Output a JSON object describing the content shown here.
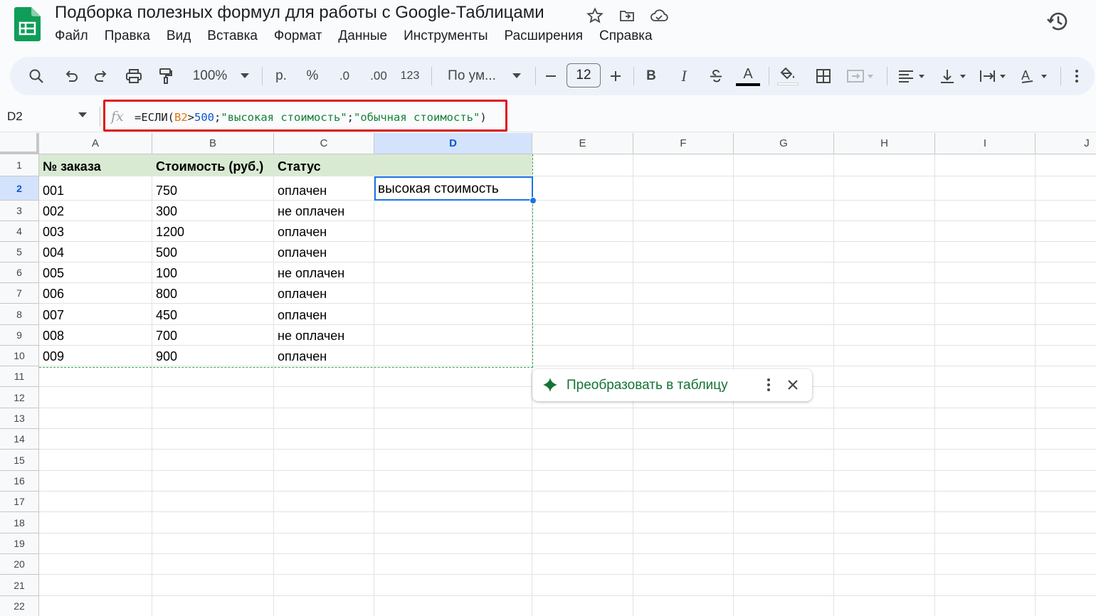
{
  "doc": {
    "title": "Подборка полезных формул для работы с Google-Таблицами"
  },
  "menu": [
    "Файл",
    "Правка",
    "Вид",
    "Вставка",
    "Формат",
    "Данные",
    "Инструменты",
    "Расширения",
    "Справка"
  ],
  "toolbar": {
    "zoom": "100%",
    "currency": "р.",
    "percent": "%",
    "decrease_decimal": ".0",
    "increase_decimal": ".00",
    "number_format": "123",
    "font": "По ум...",
    "font_size": "12",
    "bold": "B",
    "italic": "I",
    "text_color_letter": "A",
    "text_color_bar": "#000000",
    "fill_color_bar": "#ffffff"
  },
  "formula_bar": {
    "name_box": "D2",
    "fx": "fx",
    "formula": {
      "prefix": "=ЕСЛИ(",
      "ref": "B2",
      "op": ">",
      "num": "500",
      "sep1": ";",
      "str1": "\"высокая стоимость\"",
      "sep2": ";",
      "str2": "\"обычная стоимость\"",
      "suffix": ")"
    },
    "highlight_color": "#e01818"
  },
  "columns": [
    "A",
    "B",
    "C",
    "D",
    "E",
    "F",
    "G",
    "H",
    "I",
    "J"
  ],
  "selected_column": "D",
  "rows": [
    "1",
    "2",
    "3",
    "4",
    "5",
    "6",
    "7",
    "8",
    "9",
    "10",
    "11",
    "12",
    "13",
    "14",
    "15",
    "16",
    "17",
    "18",
    "19",
    "20",
    "21",
    "22"
  ],
  "selected_row": "2",
  "table": {
    "headers": [
      "№ заказа",
      "Стоимость (руб.)",
      "Статус",
      ""
    ],
    "data": [
      [
        "001",
        "750",
        "оплачен",
        "высокая стоимость"
      ],
      [
        "002",
        "300",
        "не оплачен",
        ""
      ],
      [
        "003",
        "1200",
        "оплачен",
        ""
      ],
      [
        "004",
        "500",
        "оплачен",
        ""
      ],
      [
        "005",
        "100",
        "не оплачен",
        ""
      ],
      [
        "006",
        "800",
        "оплачен",
        ""
      ],
      [
        "007",
        "450",
        "оплачен",
        ""
      ],
      [
        "008",
        "700",
        "не оплачен",
        ""
      ],
      [
        "009",
        "900",
        "оплачен",
        ""
      ]
    ],
    "header_fill": "#d9ead3"
  },
  "chip": {
    "label": "Преобразовать в таблицу",
    "color": "#137333"
  }
}
